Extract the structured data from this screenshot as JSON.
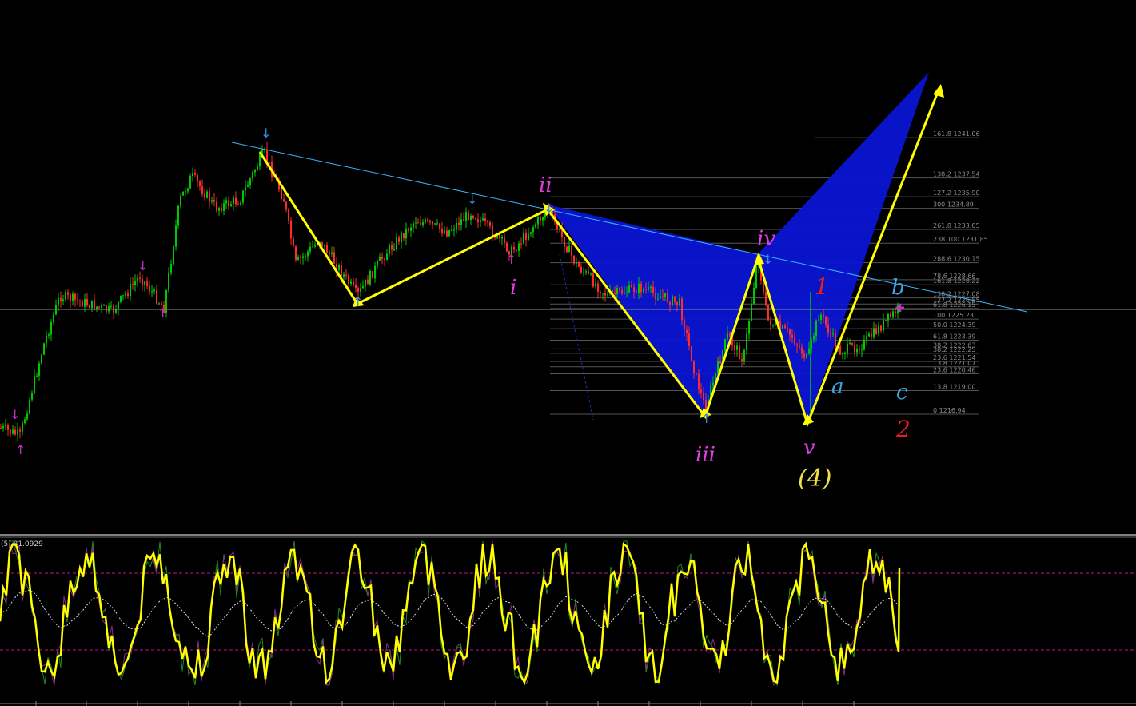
{
  "chart_data": {
    "type": "line",
    "colors": {
      "background": "#000000",
      "bull_candle": "#00c800",
      "bear_candle": "#ff2a2a",
      "zigzag": "#ffff00",
      "pattern_fill": "#0a14d2",
      "trendline": "#3ab4ff",
      "fib_line": "#666666",
      "wave_minor": "#e040e0",
      "wave_abc": "#3aa8e8",
      "wave_12": "#e81c1c",
      "wave_major": "#f0e04a",
      "oscillator": "#ffff00",
      "oscillator_level": "#c01880"
    },
    "wave_labels": [
      {
        "text": "i",
        "group": "minor"
      },
      {
        "text": "ii",
        "group": "minor"
      },
      {
        "text": "iii",
        "group": "minor"
      },
      {
        "text": "iv",
        "group": "minor"
      },
      {
        "text": "v",
        "group": "minor"
      },
      {
        "text": "(4)",
        "group": "major"
      },
      {
        "text": "1",
        "group": "wave12"
      },
      {
        "text": "2",
        "group": "wave12"
      },
      {
        "text": "a",
        "group": "abc"
      },
      {
        "text": "b",
        "group": "abc"
      },
      {
        "text": "c",
        "group": "abc"
      }
    ],
    "fib_levels": [
      {
        "label": "161.8 1241.06",
        "price": 1241.06
      },
      {
        "label": "138.2 1237.54",
        "price": 1237.54
      },
      {
        "label": "127.2 1235.90",
        "price": 1235.9
      },
      {
        "label": "300 1234.89",
        "price": 1234.89
      },
      {
        "label": "261.8 1233.05",
        "price": 1233.05
      },
      {
        "label": "238.100 1231.85",
        "price": 1231.85
      },
      {
        "label": "288.6 1230.15",
        "price": 1230.15
      },
      {
        "label": "78.6 1228.66",
        "price": 1228.66
      },
      {
        "label": "161.8 1228.22",
        "price": 1228.22
      },
      {
        "label": "138.2 1227.08",
        "price": 1227.08
      },
      {
        "label": "127.2 1226.55",
        "price": 1226.55
      },
      {
        "label": "61.8 1226.15",
        "price": 1226.15
      },
      {
        "label": "100 1225.23",
        "price": 1225.23
      },
      {
        "label": "50.0 1224.39",
        "price": 1224.39
      },
      {
        "label": "61.8 1223.39",
        "price": 1223.39
      },
      {
        "label": "38.2 1222.63",
        "price": 1222.63
      },
      {
        "label": "38.2 1222.25",
        "price": 1222.25
      },
      {
        "label": "23.6 1221.54",
        "price": 1221.54
      },
      {
        "label": "13.8 1221.07",
        "price": 1221.07
      },
      {
        "label": "23.6 1220.46",
        "price": 1220.46
      },
      {
        "label": "13.8 1219.00",
        "price": 1219.0
      },
      {
        "label": "0 1216.94",
        "price": 1216.94
      }
    ],
    "ylim": [
      1212.5,
      1243.5
    ],
    "indicator": {
      "label": "(5) 81.0929",
      "levels": [
        80,
        20
      ],
      "ylim": [
        0,
        100
      ]
    }
  }
}
